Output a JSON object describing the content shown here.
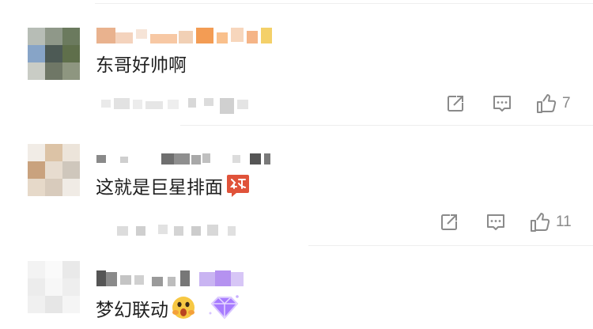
{
  "comments": [
    {
      "text": "东哥好帅啊",
      "like_count": "7",
      "icons": [
        "repost-icon",
        "comment-icon",
        "like-icon"
      ]
    },
    {
      "text": "这就是巨星排面",
      "sticker": "jingdong-badge-icon",
      "like_count": "11",
      "icons": [
        "repost-icon",
        "comment-icon",
        "like-icon"
      ]
    },
    {
      "text": "梦幻联动",
      "stickers": [
        "surprised-face-emoji",
        "purple-gem-icon"
      ]
    }
  ],
  "colors": {
    "text": "#1f1f1f",
    "icon_gray": "#8a8a8a",
    "badge_red": "#e0533a",
    "gem_purple": "#9b6bff"
  }
}
